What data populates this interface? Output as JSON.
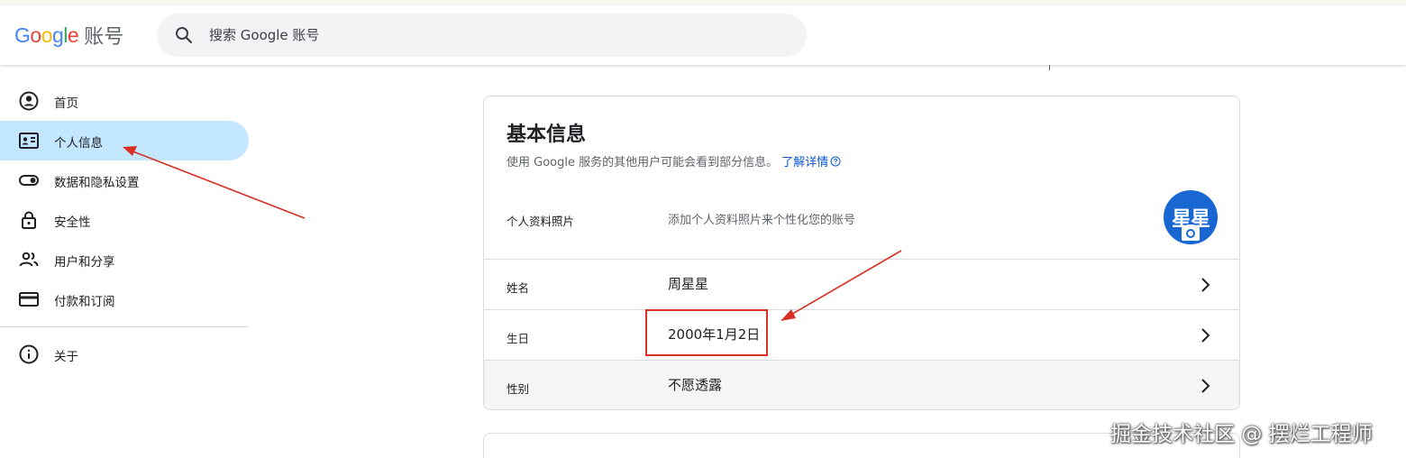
{
  "header": {
    "logo_text": "Google",
    "product_name": "账号",
    "search_placeholder": "搜索 Google 账号"
  },
  "sidebar": {
    "items": [
      {
        "label": "首页",
        "icon": "account-circle-icon"
      },
      {
        "label": "个人信息",
        "icon": "id-card-icon",
        "active": true
      },
      {
        "label": "数据和隐私设置",
        "icon": "toggle-icon"
      },
      {
        "label": "安全性",
        "icon": "lock-icon"
      },
      {
        "label": "用户和分享",
        "icon": "people-icon"
      },
      {
        "label": "付款和订阅",
        "icon": "credit-card-icon"
      }
    ],
    "footer_items": [
      {
        "label": "关于",
        "icon": "info-icon"
      }
    ]
  },
  "basic_info": {
    "title": "基本信息",
    "description": "使用 Google 服务的其他用户可能会看到部分信息。",
    "learn_more": "了解详情",
    "rows": {
      "photo": {
        "label": "个人资料照片",
        "value": "添加个人资料照片来个性化您的账号",
        "avatar_text": "星星"
      },
      "name": {
        "label": "姓名",
        "value": "周星星"
      },
      "birthday": {
        "label": "生日",
        "value": "2000年1月2日"
      },
      "gender": {
        "label": "性别",
        "value": "不愿透露"
      }
    }
  },
  "watermark": "掘金技术社区 @ 摆烂工程师",
  "colors": {
    "active_nav": "#c2e7ff",
    "link": "#0b57d0",
    "avatar_bg": "#1967d2",
    "annotation_red": "#d93025"
  }
}
